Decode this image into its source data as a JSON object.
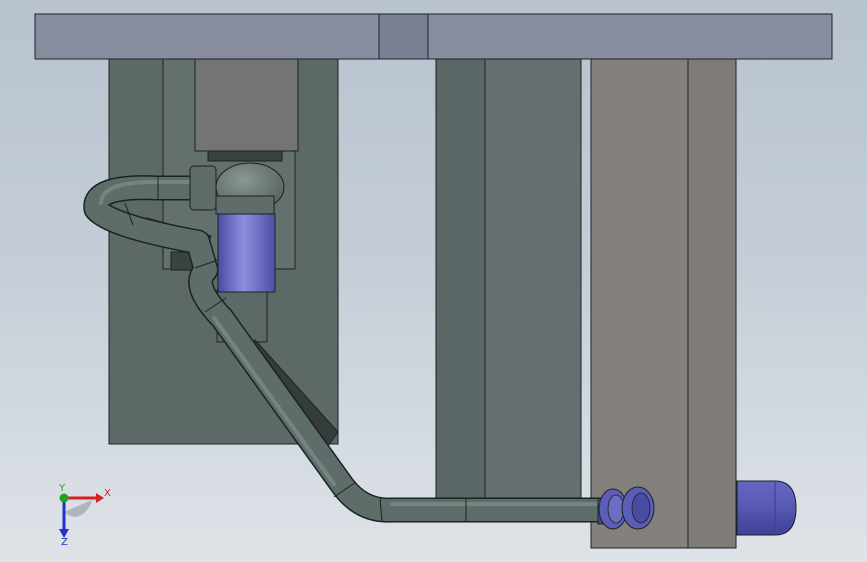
{
  "scene": {
    "background_top": "#b8c3cf",
    "background_bottom": "#dfe3e8"
  },
  "colors": {
    "top_plate": "#878b9e",
    "top_plate_center": "#7a7f90",
    "dark_block": "#5b6868",
    "mid_block": "#64716f",
    "right_block": "#84817c",
    "cap_block": "#737578",
    "pipe": "#5e6d6a",
    "pipe_highlight": "#7f8e8b",
    "fitting_blue": "#5a5cb4",
    "fitting_blue_light": "#8385d6",
    "edge": "#1b2222"
  },
  "triad": {
    "x_label": "X",
    "y_label": "Y",
    "z_label": "Z",
    "x_color": "#d22222",
    "y_color": "#22a022",
    "z_color": "#2030c8"
  }
}
